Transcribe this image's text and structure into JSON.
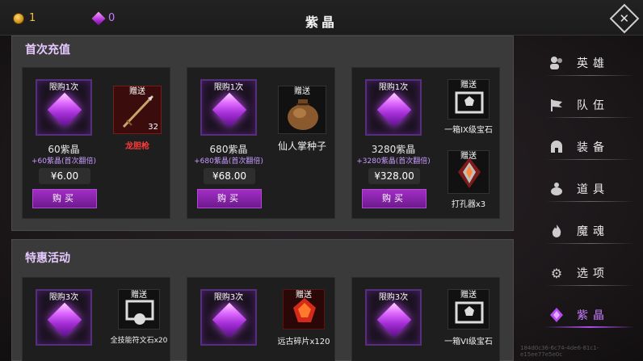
{
  "topbar": {
    "title": "紫晶",
    "coins": "1",
    "gems": "0"
  },
  "sections": [
    {
      "title": "首次充值",
      "cards": [
        {
          "limit": "限购1次",
          "name": "60紫晶",
          "bonus": "+60紫晶(首次翻倍)",
          "price": "¥6.00",
          "buy": "购买",
          "gifts": [
            {
              "tag": "赠送",
              "name": "龙胆枪",
              "qty": "32",
              "icon": "spear-icon",
              "red": true
            }
          ]
        },
        {
          "limit": "限购1次",
          "name": "680紫晶",
          "bonus": "+680紫晶(首次翻倍)",
          "price": "¥68.00",
          "buy": "购买",
          "gifts": [
            {
              "tag": "赠送",
              "name": "仙人掌种子",
              "icon": "seed-bag-icon"
            }
          ]
        },
        {
          "limit": "限购1次",
          "name": "3280紫晶",
          "bonus": "+3280紫晶(首次翻倍)",
          "price": "¥328.00",
          "buy": "购买",
          "gifts": [
            {
              "tag": "赠送",
              "name": "一箱IX级宝石",
              "icon": "gem-chest-icon"
            },
            {
              "tag": "赠送",
              "name": "打孔器x3",
              "icon": "drill-icon"
            }
          ]
        }
      ]
    },
    {
      "title": "特惠活动",
      "cards": [
        {
          "limit": "限购3次",
          "gifts": [
            {
              "tag": "赠送",
              "name": "全技能符文石x20",
              "icon": "rune-chest-icon"
            }
          ]
        },
        {
          "limit": "限购3次",
          "gifts": [
            {
              "tag": "赠送",
              "name": "远古碎片x120",
              "icon": "ancient-shard-icon"
            }
          ]
        },
        {
          "limit": "限购3次",
          "gifts": [
            {
              "tag": "赠送",
              "name": "一箱VI级宝石",
              "icon": "gem-chest-icon"
            }
          ]
        }
      ]
    }
  ],
  "sidebar": {
    "items": [
      {
        "label": "英雄",
        "icon": "heroes-icon"
      },
      {
        "label": "队伍",
        "icon": "flag-icon"
      },
      {
        "label": "装备",
        "icon": "helmet-icon"
      },
      {
        "label": "道具",
        "icon": "bag-icon"
      },
      {
        "label": "魔魂",
        "icon": "flame-icon"
      },
      {
        "label": "选项",
        "icon": "gear-icon"
      },
      {
        "label": "紫晶",
        "icon": "gem-icon",
        "active": true
      }
    ]
  },
  "footer_id": "184d0c36-6c74-4de6-81c1-e15ee77e5e0c"
}
